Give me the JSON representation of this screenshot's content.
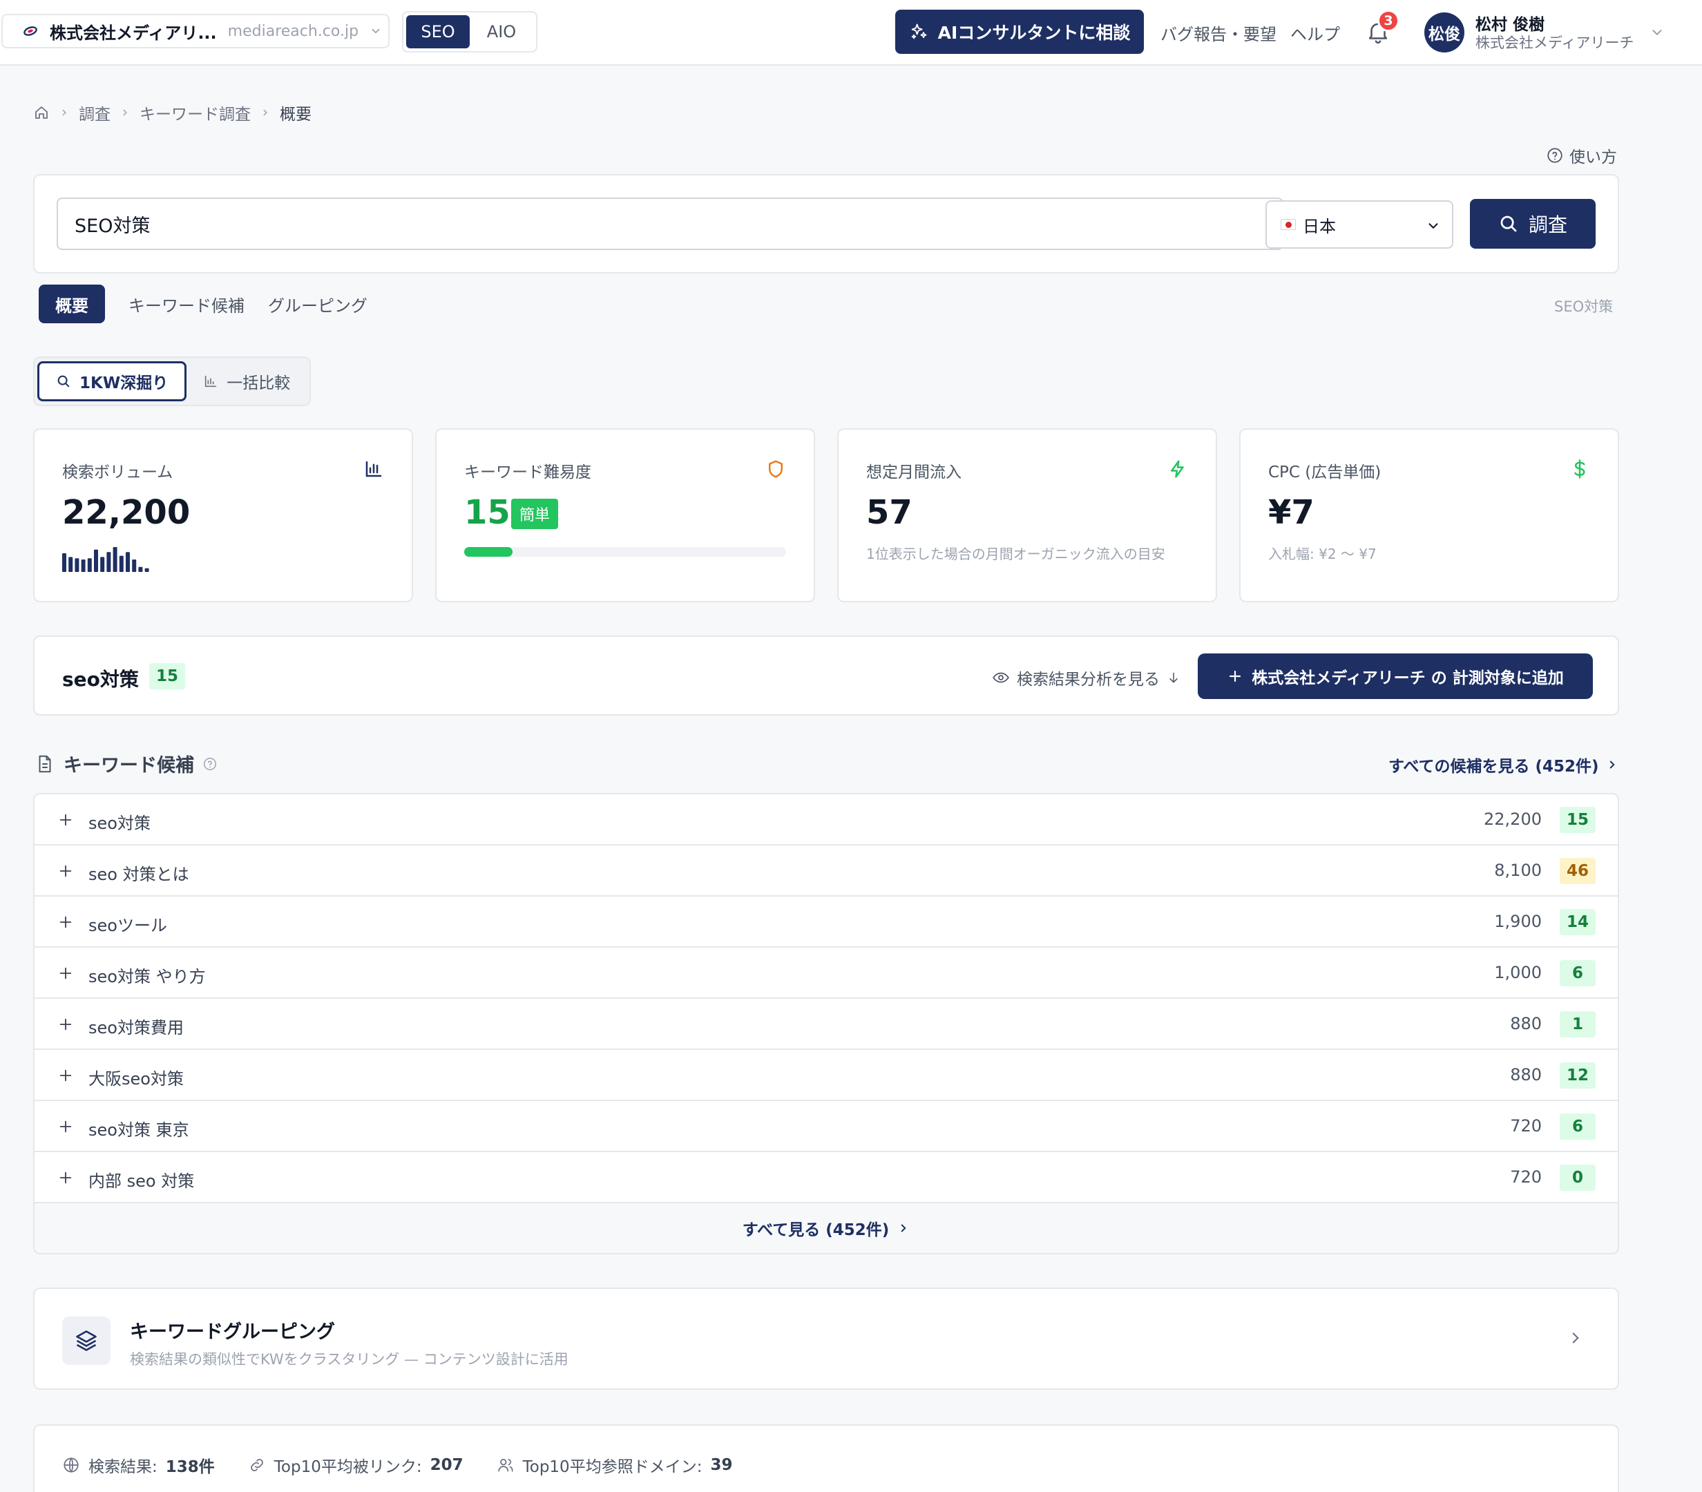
{
  "header": {
    "site_name": "株式会社メディアリ...",
    "site_domain": "mediareach.co.jp",
    "mode_seo": "SEO",
    "mode_aio": "AIO",
    "ai_button": "AIコンサルタントに相談",
    "bug_report": "バグ報告・要望",
    "help": "ヘルプ",
    "notification_count": "3",
    "avatar_initials": "松俊",
    "user_name": "松村 俊樹",
    "user_org": "株式会社メディアリーチ"
  },
  "breadcrumb": {
    "items": [
      "調査",
      "キーワード調査",
      "概要"
    ]
  },
  "help_link": "使い方",
  "search": {
    "query": "SEO対策",
    "country": "日本",
    "button": "調査"
  },
  "tabs": {
    "items": [
      "概要",
      "キーワード候補",
      "グルーピング"
    ],
    "active": "概要",
    "right_label": "SEO対策"
  },
  "sub_toggle": {
    "deep_dive": "1KW深掘り",
    "bulk_compare": "一括比較"
  },
  "metrics": {
    "volume": {
      "label": "検索ボリューム",
      "value": "22,200",
      "trend": [
        0.75,
        0.6,
        0.55,
        0.5,
        0.55,
        0.9,
        0.6,
        0.8,
        1.0,
        0.65,
        0.8,
        0.5,
        0.2,
        0.15
      ]
    },
    "difficulty": {
      "label": "キーワード難易度",
      "value": "15",
      "badge": "簡単",
      "progress": 0.15
    },
    "traffic": {
      "label": "想定月間流入",
      "value": "57",
      "sub": "1位表示した場合の月間オーガニック流入の目安"
    },
    "cpc": {
      "label": "CPC (広告単価)",
      "value": "¥7",
      "sub": "入札幅: ¥2 〜 ¥7"
    }
  },
  "keyword_card": {
    "keyword": "seo対策",
    "difficulty": "15",
    "serp_link": "検索結果分析を見る",
    "add_button": "株式会社メディアリーチ の 計測対象に追加"
  },
  "candidates": {
    "title": "キーワード候補",
    "view_all": "すべての候補を見る (452件)",
    "footer": "すべて見る (452件)",
    "rows": [
      {
        "keyword": "seo対策",
        "volume": "22,200",
        "difficulty": "15",
        "level": "green"
      },
      {
        "keyword": "seo 対策とは",
        "volume": "8,100",
        "difficulty": "46",
        "level": "yellow"
      },
      {
        "keyword": "seoツール",
        "volume": "1,900",
        "difficulty": "14",
        "level": "green"
      },
      {
        "keyword": "seo対策 やり方",
        "volume": "1,000",
        "difficulty": "6",
        "level": "green"
      },
      {
        "keyword": "seo対策費用",
        "volume": "880",
        "difficulty": "1",
        "level": "green"
      },
      {
        "keyword": "大阪seo対策",
        "volume": "880",
        "difficulty": "12",
        "level": "green"
      },
      {
        "keyword": "seo対策 東京",
        "volume": "720",
        "difficulty": "6",
        "level": "green"
      },
      {
        "keyword": "内部 seo 対策",
        "volume": "720",
        "difficulty": "0",
        "level": "green"
      }
    ]
  },
  "grouping": {
    "title": "キーワードグルーピング",
    "sub": "検索結果の類似性でKWをクラスタリング — コンテンツ設計に活用"
  },
  "stats": {
    "results_label": "検索結果:",
    "results_value": "138件",
    "backlinks_label": "Top10平均被リンク:",
    "backlinks_value": "207",
    "domains_label": "Top10平均参照ドメイン:",
    "domains_value": "39"
  },
  "colors": {
    "primary": "#1e2f63",
    "easy_green": "#22c55e",
    "shield_orange": "#ea7a17",
    "bolt_green": "#22c55e",
    "badge_red": "#ef4444"
  }
}
